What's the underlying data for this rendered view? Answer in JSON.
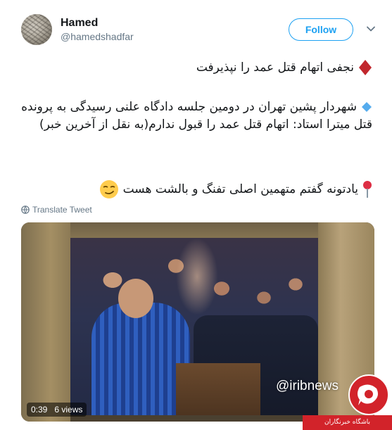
{
  "user": {
    "display_name": "Hamed",
    "handle": "@hamedshadfar",
    "follow_label": "Follow"
  },
  "tweet": {
    "line1": "نجفی اتهام قتل عمد را نپذیرفت",
    "line2": "شهردار پشین تهران در دومین جلسه دادگاه علنی رسیدگی به پرونده قتل میترا استاد: اتهام قتل عمد را قبول ندارم(به نقل از آخرین خبر)",
    "line3": "یادتونه گفتم متهمین اصلی تفنگ و بالشت هست",
    "icons": [
      "red-diamond-icon",
      "blue-diamond-icon",
      "pin-icon",
      "smirk-emoji-icon"
    ]
  },
  "translate_label": "Translate Tweet",
  "video": {
    "watermark": "@iribnews",
    "duration": "0:39",
    "views": "6 views"
  },
  "corner_logo": {
    "banner_text": "باشگاه خبرنگاران",
    "colors": {
      "brand": "#d2232a"
    }
  },
  "colors": {
    "accent": "#1da1f2",
    "text": "#14171a",
    "muted": "#657786"
  }
}
